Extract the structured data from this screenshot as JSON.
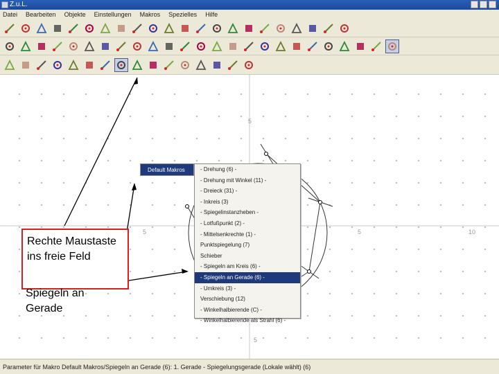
{
  "window": {
    "title": "Z.u.L."
  },
  "menu": [
    "Datei",
    "Bearbeiten",
    "Objekte",
    "Einstellungen",
    "Makros",
    "Spezielles",
    "Hilfe"
  ],
  "toolbar_rows": [
    [
      "new-file-icon",
      "open-file-icon",
      "save-icon",
      "undo-icon",
      "edit-icon",
      "redo-icon",
      "hammer-icon",
      "paint-icon",
      "ruler-icon",
      "hatch-icon",
      "tools-icon",
      "clipboard-icon",
      "function-icon",
      "double-arrow-icon",
      "black-square-icon",
      "dot-icon",
      "line-icon",
      "zoom-icon",
      "axes-icon",
      "wand-icon",
      "palette-icon",
      "info-icon"
    ],
    [
      "point-icon",
      "segment-icon",
      "line-tool-icon",
      "ray-icon",
      "vector-icon",
      "circle-icon",
      "circle2-icon",
      "circle3-icon",
      "fixed-segment-icon",
      "intersect-icon",
      "midpoint-icon",
      "parallel-icon",
      "perpendicular-icon",
      "angle-icon",
      "area-icon",
      "locus-icon",
      "expression-icon",
      "text-icon",
      "image-icon",
      "formula-icon",
      "polygon-icon",
      "conic-icon",
      "text-tool-icon",
      "magic-icon",
      "active-gear-icon"
    ],
    [
      "pin-icon",
      "triangle-icon",
      "reflect-point-icon",
      "reflect-line-icon",
      "rotate-icon",
      "translate-icon",
      "circle-reflect-icon",
      "active-tool-icon",
      "ring-icon",
      "dots-icon",
      "curve-icon",
      "spiral-icon",
      "tangent-icon",
      "arc-icon",
      "misc-icon",
      "misc2-icon"
    ]
  ],
  "canvas": {
    "y_tick_top": "5",
    "y_tick_bottom": "5",
    "x_tick_left": "5",
    "x_tick_right": "5",
    "x_tick_far": "10"
  },
  "context_menu": {
    "submenu_label": "Default Makros",
    "items": [
      "- Drehung (6) -",
      "- Drehung mit Winkel (11) -",
      "- Dreieck (31) -",
      "- Inkreis (3)",
      "- Spiegelinstanzheben -",
      "- Lotfußpunkt (2) -",
      "- Mittelsenkrechte (1) -",
      "Punktspiegelung (7)",
      "Schieber",
      "- Spiegeln am Kreis (6) -",
      "- Spiegeln an Gerade (6) -",
      "- Umkreis (3) -",
      "Verschiebung (12)",
      "- Winkelhalbierende (C) -",
      "- Winkelhalbierende als Strahl (6) -"
    ],
    "highlighted_index": 10
  },
  "callout": {
    "line1": "Rechte Maustaste ins freie Feld",
    "line2": "Spiegeln an Gerade"
  },
  "status": {
    "text": "Parameter für Makro Default Makros/Spiegeln an Gerade (6): 1. Gerade - Spiegelungsgerade (Lokale wählt) (6)"
  },
  "colors": {
    "titlebar": "#1b4a9c",
    "highlight": "#1f3a7a",
    "callout_border": "#d42020"
  }
}
